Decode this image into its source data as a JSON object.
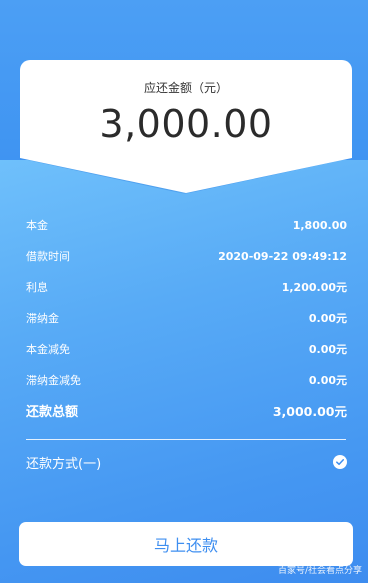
{
  "summary": {
    "label": "应还金额（元）",
    "amount": "3,000.00"
  },
  "details": [
    {
      "label": "本金",
      "value": "1,800.00"
    },
    {
      "label": "借款时间",
      "value": "2020-09-22 09:49:12"
    },
    {
      "label": "利息",
      "value": "1,200.00元"
    },
    {
      "label": "滞纳金",
      "value": "0.00元"
    },
    {
      "label": "本金减免",
      "value": "0.00元"
    },
    {
      "label": "滞纳金减免",
      "value": "0.00元"
    }
  ],
  "total": {
    "label": "还款总额",
    "value": "3,000.00元"
  },
  "payment_method": {
    "label": "还款方式(一)",
    "checked": true
  },
  "pay_button": {
    "label": "马上还款"
  },
  "watermark": "百家号/社会看点分享",
  "colors": {
    "accent": "#3f8ff0",
    "background": "#4a9bf2",
    "card": "#ffffff"
  }
}
